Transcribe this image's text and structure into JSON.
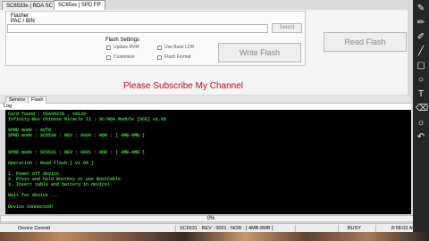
{
  "tabs": [
    "SC6533x | RDA SC",
    "SC65xx | SPD FP"
  ],
  "flasher": {
    "title": "Flasher",
    "pac_label": "PAC / BIN",
    "path_value": "",
    "select_label": "Select"
  },
  "settings": {
    "title": "Flash Settings",
    "options": [
      {
        "label": "Update RVM",
        "checked": false
      },
      {
        "label": "Use Base LDR",
        "checked": false
      },
      {
        "label": "Customize",
        "checked": false
      },
      {
        "label": "Flash Format",
        "checked": false
      }
    ]
  },
  "buttons": {
    "write_flash": "Write Flash",
    "read_flash": "Read Flash"
  },
  "banner": "Please Subscribe My Channel",
  "lower_tabs": [
    "Service",
    "Flash"
  ],
  "log_label": "Log",
  "log_lines": [
    "Card found : CEA4927D , v0139",
    "Infinity-Box Chinese Miracle II : SC/RDA Module [SCE] v1.05",
    "",
    "SPRD mode : AUTO",
    "SPRD mode : SC6530 : REV : 0000 : NOR : [ 4MB-8MB ]",
    "",
    "",
    "SPRD mode : SC6531 : REV : 0001 : NOR : [ 4MB-8MB ]",
    "",
    "Operation : Read Flash [ v1.05 ]",
    "",
    "1. Power off device",
    "2. Press and hold BootKey or use BootCable",
    "3. Insert cable and battery in device!",
    "",
    "Wait for device ...",
    "",
    "Device Connected!"
  ],
  "progress": {
    "text": "0%",
    "value": 0
  },
  "status": {
    "left": "Device Conntd",
    "chip": "SC6531 : REV : 0001 : NOR : [ 4MB-8MB ]",
    "state": "BUSY",
    "time": "8:58:03 AM"
  },
  "toolbar_icons": [
    "pen-icon",
    "marker-icon",
    "highlighter-icon",
    "line-icon",
    "rectangle-icon",
    "circle-icon",
    "text-icon",
    "eraser-icon",
    "brightness-icon",
    "undo-icon"
  ]
}
